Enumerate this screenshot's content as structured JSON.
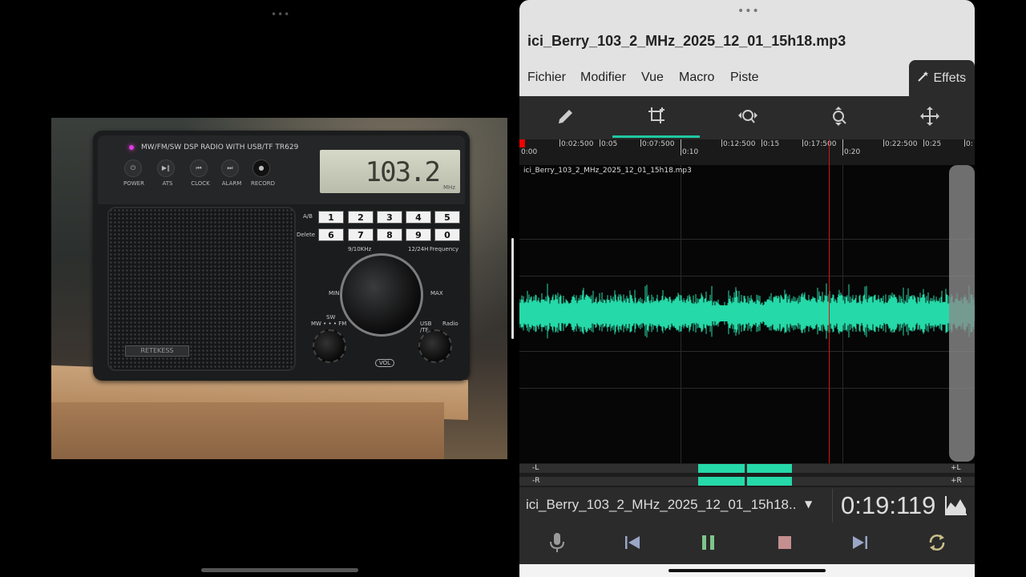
{
  "left_pane": {
    "handle": "•••",
    "radio": {
      "model_text": "MW/FM/SW DSP RADIO WITH USB/TF  TR629",
      "lcd_value": "103.2",
      "lcd_unit": "MHz",
      "buttons": [
        "POWER",
        "ATS",
        "CLOCK",
        "ALARM",
        "RECORD"
      ],
      "keypad_top": [
        "1",
        "2",
        "3",
        "4",
        "5"
      ],
      "keypad_bottom": [
        "6",
        "7",
        "8",
        "9",
        "0"
      ],
      "keypad_labels": {
        "ab": "A/B",
        "delete": "Delete",
        "step": "9/10KHz",
        "hour": "12/24H",
        "freq": "Frequency",
        "min": "MIN",
        "max": "MAX",
        "vol": "VOL",
        "sw": "SW",
        "band": "MW • • • FM",
        "usb": "USB /TF",
        "radio": "Radio"
      },
      "brand": "RETEKESS"
    }
  },
  "app": {
    "handle": "•••",
    "file_title": "ici_Berry_103_2_MHz_2025_12_01_15h18.mp3",
    "menu": [
      "Fichier",
      "Modifier",
      "Vue",
      "Macro",
      "Piste"
    ],
    "effects_label": "Effets",
    "tools": [
      {
        "icon": "pencil-icon",
        "active": false
      },
      {
        "icon": "crop-icon",
        "active": true
      },
      {
        "icon": "zoom-horizontal-icon",
        "active": false
      },
      {
        "icon": "zoom-vertical-icon",
        "active": false
      },
      {
        "icon": "move-icon",
        "active": false
      }
    ],
    "ruler_labels": [
      "0:00",
      "0:02:500",
      "0:05",
      "0:07:500",
      "0:10",
      "0:12:500",
      "0:15",
      "0:17:500",
      "0:20",
      "0:22:500",
      "0:25",
      "0:"
    ],
    "track_name": "ici_Berry_103_2_MHz_2025_12_01_15h18.mp3",
    "meter_left": {
      "left_label": "-L",
      "right_label": "+L"
    },
    "meter_right": {
      "left_label": "-R",
      "right_label": "+R"
    },
    "status": {
      "file": "ici_Berry_103_2_MHz_2025_12_01_15h18..",
      "time": "0:19:119"
    },
    "colors": {
      "accent": "#1ec9a0",
      "waveform": "#25d9a8",
      "playhead": "#d21818"
    }
  }
}
